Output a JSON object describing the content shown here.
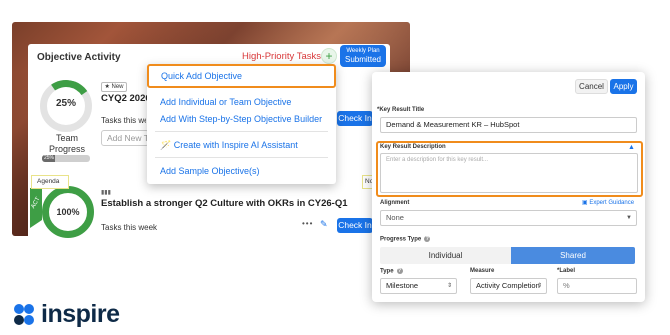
{
  "panel": {
    "title": "Objective Activity",
    "high_priority_tasks": "High-Priority Tasks",
    "add_symbol": "+",
    "weekly_plan_line1": "Weekly Plan",
    "weekly_plan_line2": "Submitted"
  },
  "objective1": {
    "progress_percent": "25%",
    "progress_label": "Team Progress",
    "mini_bar_value": "25%",
    "badge": "New",
    "title": "CYQ2 2026",
    "tasks_label": "Tasks this week",
    "add_placeholder": "Add New T",
    "checkin_label": "Check In"
  },
  "objective2": {
    "tag": "Agenda",
    "ribbon": "ACT",
    "progress_percent": "100%",
    "title": "Establish a stronger Q2 Culture with OKRs in CY26-Q1",
    "tasks_label": "Tasks this week",
    "more_icon": "•••",
    "checkin_label": "Check In",
    "side_tag": "No"
  },
  "add_menu": {
    "items": [
      "Quick Add Objective",
      "Add Individual or Team Objective",
      "Add With Step-by-Step Objective Builder",
      "Create with Inspire AI Assistant",
      "Add Sample Objective(s)"
    ]
  },
  "kr_dialog": {
    "cancel_label": "Cancel",
    "apply_label": "Apply",
    "kr_title_label": "*Key Result Title",
    "kr_title_value": "Demand & Measurement KR – HubSpot",
    "description_label": "Key Result Description",
    "description_placeholder": "Enter a description for this key result...",
    "alignment_label": "Alignment",
    "expert_guidance": "Expert Guidance",
    "alignment_value": "None",
    "progress_type_label": "Progress Type",
    "progress_type_options": [
      "Individual",
      "Shared"
    ],
    "progress_type_selected": "Shared",
    "type_label": "Type",
    "type_value": "Milestone",
    "measure_label": "Measure",
    "measure_value": "Activity Completion",
    "unit_label": "*Label",
    "unit_value": "%"
  },
  "brand": {
    "logo_text": "inspire",
    "accent": "#1a73e8",
    "highlight": "#f08c1c",
    "success": "#3e9e45"
  }
}
